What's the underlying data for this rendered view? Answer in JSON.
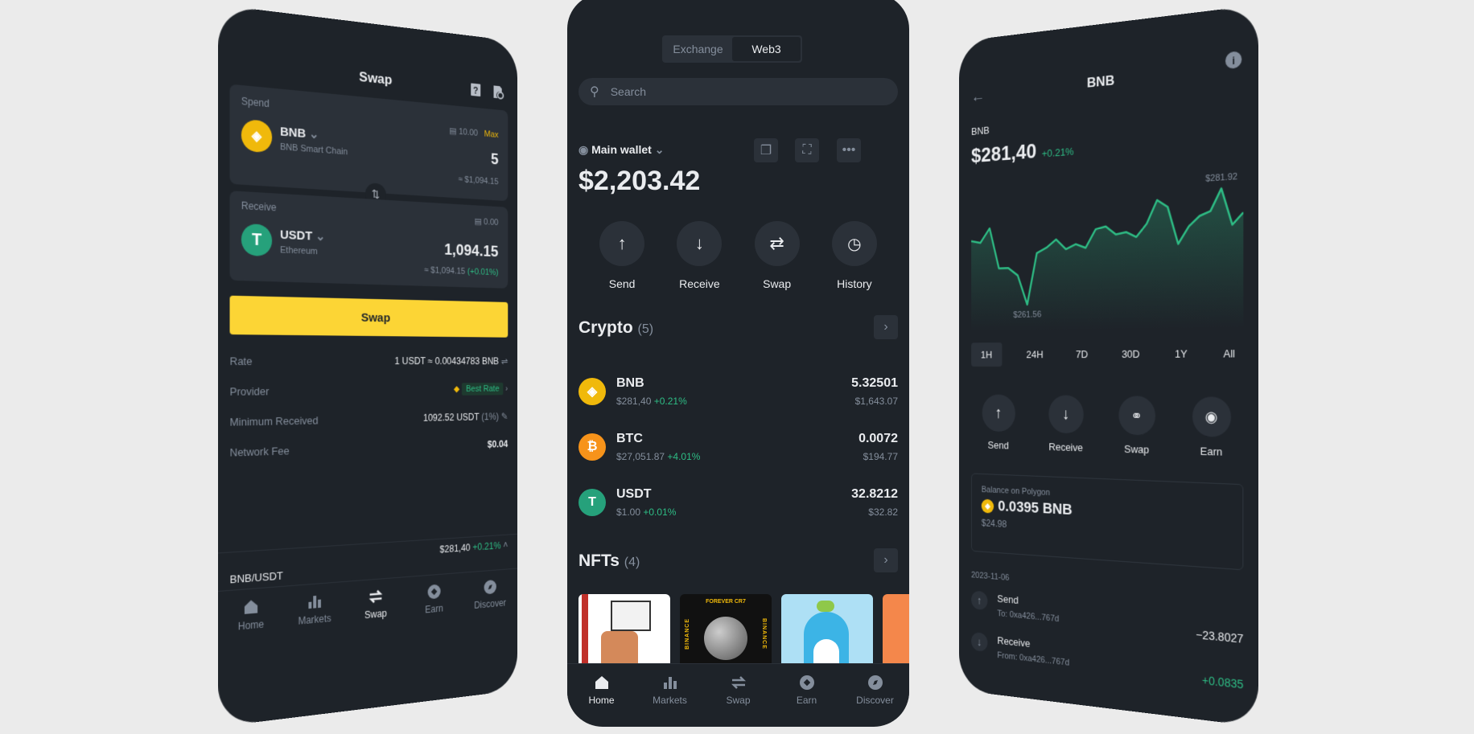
{
  "colors": {
    "background": "#ebebeb",
    "phone": "#1e2329",
    "card": "#2b3139",
    "accent": "#fcd535",
    "positive": "#2ebd85",
    "muted": "#848e9c"
  },
  "swap_screen": {
    "title": "Swap",
    "header_icons": [
      "help-book-icon",
      "order-history-icon"
    ],
    "spend": {
      "label": "Spend",
      "balance": "10.00",
      "max_label": "Max",
      "token": "BNB",
      "network": "BNB Smart Chain",
      "amount": "5",
      "usd": "≈ $1,094.15"
    },
    "receive": {
      "label": "Receive",
      "balance": "0.00",
      "token": "USDT",
      "network": "Ethereum",
      "amount": "1,094.15",
      "usd": "≈ $1,094.15",
      "change": "(+0.01%)"
    },
    "swap_button": "Swap",
    "details": [
      {
        "label": "Rate",
        "value": "1 USDT ≈ 0.00434783 BNB"
      },
      {
        "label": "Provider",
        "value": "Best Rate"
      },
      {
        "label": "Minimum Received",
        "value": "1092.52 USDT",
        "extra": "(1%)"
      },
      {
        "label": "Network Fee",
        "value": "$0.04"
      }
    ],
    "pair": {
      "name": "BNB/USDT",
      "price": "$281,40",
      "change": "+0.21%"
    },
    "tabs": [
      "Home",
      "Markets",
      "Swap",
      "Earn",
      "Discover"
    ],
    "active_tab": "Swap"
  },
  "wallet_screen": {
    "segments": [
      "Exchange",
      "Web3"
    ],
    "active_segment": "Web3",
    "search_placeholder": "Search",
    "wallet_name": "Main wallet",
    "balance": "$2,203.42",
    "actions": [
      "Send",
      "Receive",
      "Swap",
      "History"
    ],
    "crypto": {
      "title": "Crypto",
      "count": "(5)",
      "items": [
        {
          "symbol": "BNB",
          "price": "$281,40",
          "change": "+0.21%",
          "amount": "5.32501",
          "value": "$1,643.07",
          "color": "#f0b90b"
        },
        {
          "symbol": "BTC",
          "price": "$27,051.87",
          "change": "+4.01%",
          "amount": "0.0072",
          "value": "$194.77",
          "color": "#f7931a"
        },
        {
          "symbol": "USDT",
          "price": "$1.00",
          "change": "+0.01%",
          "amount": "32.8212",
          "value": "$32.82",
          "color": "#26a17b"
        }
      ]
    },
    "nfts": {
      "title": "NFTs",
      "count": "(4)",
      "cr7_text": "FOREVER CR7",
      "binance_text": "BINANCE"
    },
    "tabs": [
      "Home",
      "Markets",
      "Swap",
      "Earn",
      "Discover"
    ],
    "active_tab": "Home"
  },
  "token_screen": {
    "title": "BNB",
    "symbol": "BNB",
    "price": "$281,40",
    "change": "+0.21%",
    "ranges": [
      "1H",
      "24H",
      "7D",
      "30D",
      "1Y",
      "All"
    ],
    "active_range": "1H",
    "actions": [
      "Send",
      "Receive",
      "Swap",
      "Earn"
    ],
    "balance_card": {
      "label": "Balance on Polygon",
      "amount": "0.0395 BNB",
      "usd": "$24.98"
    },
    "history_date": "2023-11-06",
    "transactions": [
      {
        "type": "Send",
        "address": "To: 0xa426...767d",
        "amount": "−23.8027"
      },
      {
        "type": "Receive",
        "address": "From: 0xa426...767d",
        "amount": "+0.0835"
      }
    ]
  },
  "chart_data": {
    "type": "area",
    "title": "",
    "xlabel": "",
    "ylabel": "",
    "grid": false,
    "ylim": [
      258,
      284
    ],
    "max_label": "$281.92",
    "min_label": "$261.56",
    "values": [
      274.44,
      274.01,
      276.82,
      268.82,
      268.82,
      267.31,
      261.56,
      271.5,
      272.5,
      274.01,
      272.06,
      272.93,
      272.15,
      275.61,
      276.04,
      274.44,
      274.79,
      273.79,
      276.17,
      280.49,
      279.11,
      272.15,
      275.31,
      277.12,
      277.9,
      281.92,
      275.22,
      277.34
    ],
    "line_color": "#2ebd85"
  }
}
